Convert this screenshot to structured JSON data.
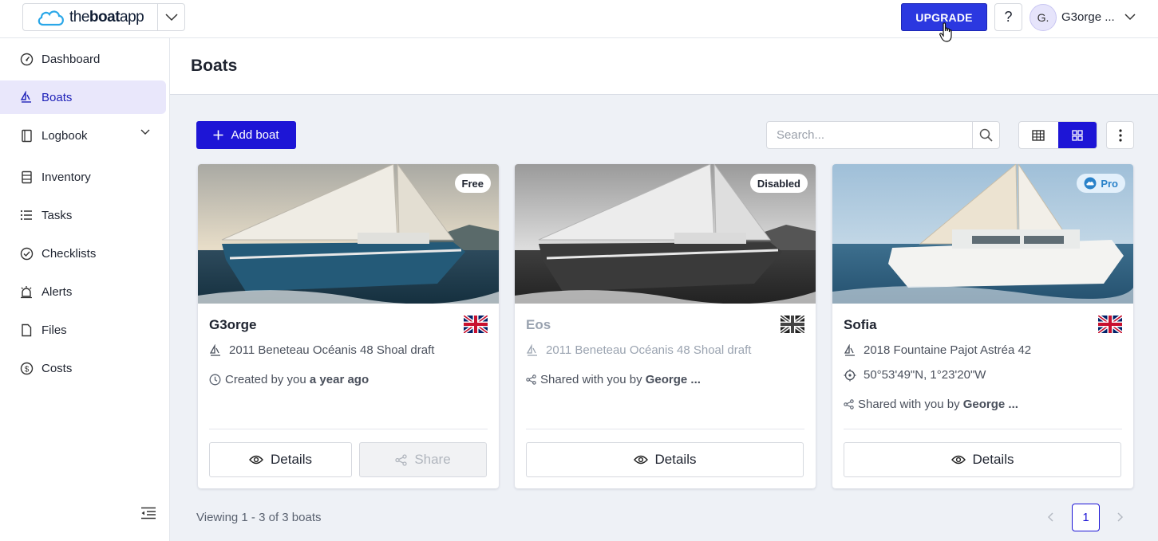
{
  "app": {
    "brand_light": "the",
    "brand_bold": "boat",
    "brand_suffix": "app",
    "upgrade_label": "UPGRADE",
    "help_label": "?",
    "user_initials": "G.",
    "user_name": "G3orge ..."
  },
  "sidebar": {
    "items": [
      {
        "label": "Dashboard",
        "icon": "gauge-icon"
      },
      {
        "label": "Boats",
        "icon": "sailboat-icon",
        "active": true
      },
      {
        "label": "Logbook",
        "icon": "book-icon"
      },
      {
        "label": "Inventory",
        "icon": "inventory-icon"
      },
      {
        "label": "Tasks",
        "icon": "list-icon"
      },
      {
        "label": "Checklists",
        "icon": "check-circle-icon"
      },
      {
        "label": "Alerts",
        "icon": "alarm-icon"
      },
      {
        "label": "Files",
        "icon": "file-icon"
      },
      {
        "label": "Costs",
        "icon": "dollar-circle-icon"
      }
    ]
  },
  "main": {
    "title": "Boats",
    "add_label": "Add boat",
    "search_placeholder": "Search...",
    "footer_count": "Viewing 1 - 3 of 3 boats",
    "current_page": "1"
  },
  "boats": [
    {
      "name": "G3orge",
      "badge": "Free",
      "model": "2011 Beneteau Océanis 48 Shoal draft",
      "info_prefix": "Created by you ",
      "info_bold": "a year ago",
      "details_label": "Details",
      "share_label": "Share"
    },
    {
      "name": "Eos",
      "badge": "Disabled",
      "model": "2011 Beneteau Océanis 48 Shoal draft",
      "info_prefix": "Shared with you by ",
      "info_bold": "George ...",
      "details_label": "Details"
    },
    {
      "name": "Sofia",
      "badge": "Pro",
      "model": "2018 Fountaine Pajot Astréa 42",
      "position": "50°53'49\"N, 1°23'20\"W",
      "info_prefix": "Shared with you by ",
      "info_bold": "George ...",
      "details_label": "Details"
    }
  ],
  "colors": {
    "accent": "#1d15d6",
    "upgrade": "#2b38e0",
    "active_nav_bg": "#e9e7fb",
    "page_bg": "#eef1f6"
  }
}
